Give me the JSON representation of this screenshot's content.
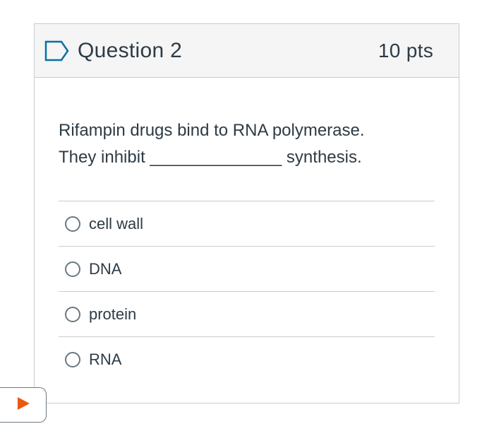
{
  "question": {
    "title": "Question 2",
    "points": "10 pts",
    "flag_icon": "flag-outline-icon",
    "text_line1": "Rifampin drugs bind to RNA polymerase.",
    "text_line2": "They inhibit ______________ synthesis.",
    "answers": [
      {
        "label": "cell wall",
        "selected": false
      },
      {
        "label": "DNA",
        "selected": false
      },
      {
        "label": "protein",
        "selected": false
      },
      {
        "label": "RNA",
        "selected": false
      }
    ]
  },
  "colors": {
    "header_bg": "#f5f5f5",
    "border": "#c7cdd1",
    "text": "#2d3b45",
    "flag": "#0770a3",
    "play": "#e8590c"
  },
  "play_tab": {
    "icon": "play-icon"
  }
}
